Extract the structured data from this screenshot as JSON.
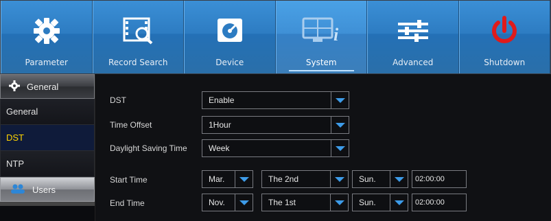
{
  "toolbar": {
    "tabs": [
      {
        "label": "Parameter",
        "icon": "gear-icon"
      },
      {
        "label": "Record Search",
        "icon": "film-search-icon"
      },
      {
        "label": "Device",
        "icon": "disk-icon"
      },
      {
        "label": "System",
        "icon": "monitor-info-icon"
      },
      {
        "label": "Advanced",
        "icon": "sliders-icon"
      },
      {
        "label": "Shutdown",
        "icon": "power-icon"
      }
    ],
    "active": "System",
    "colors": {
      "tab": "#2d7cc2",
      "power": "#e01b1b",
      "dropdown_arrow": "#3d9be8",
      "selected_text": "#ffd400"
    }
  },
  "sidebar": {
    "header": "General",
    "items": [
      "General",
      "DST",
      "NTP"
    ],
    "selected": "DST",
    "footer": "Users"
  },
  "form": {
    "dst": {
      "label": "DST",
      "value": "Enable"
    },
    "time_offset": {
      "label": "Time Offset",
      "value": "1Hour"
    },
    "dst_mode": {
      "label": "Daylight Saving Time",
      "value": "Week"
    },
    "start": {
      "label": "Start Time",
      "month": "Mar.",
      "week": "The 2nd",
      "day": "Sun.",
      "time": "02:00:00"
    },
    "end": {
      "label": "End Time",
      "month": "Nov.",
      "week": "The 1st",
      "day": "Sun.",
      "time": "02:00:00"
    }
  }
}
